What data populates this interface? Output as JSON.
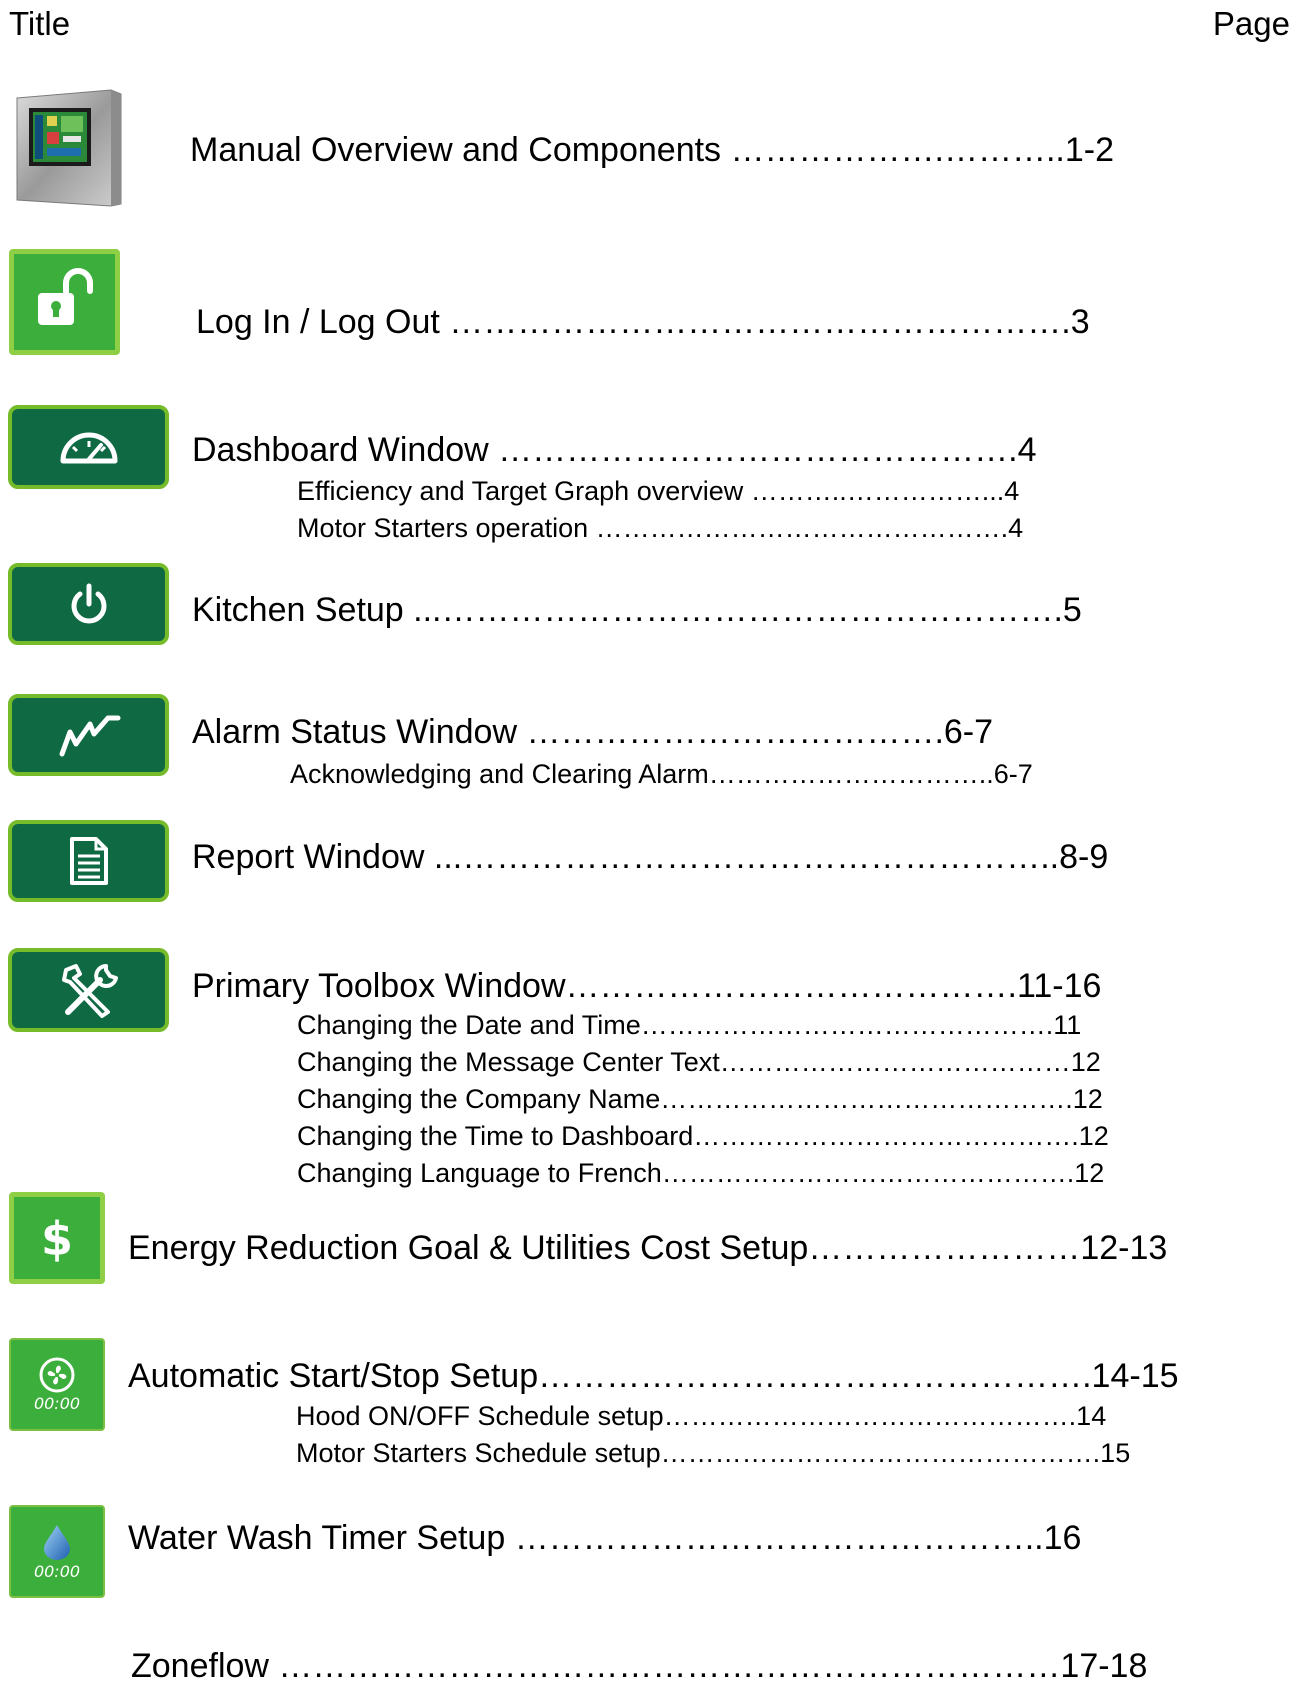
{
  "header": {
    "title_label": "Title",
    "page_label": "Page"
  },
  "colors": {
    "button_dark_green": "#0f6a44",
    "button_border_lime": "#76bb2a",
    "button_bright_green": "#3cae3b"
  },
  "entries": [
    {
      "text": "Manual Overview and Components ……………….………..1-2",
      "icon": "control-panel-photo"
    },
    {
      "text": "Log In / Log Out ……………………………………………….3",
      "icon": "padlock-open-icon"
    },
    {
      "text": "Dashboard Window ……………………………………….4",
      "icon": "gauge-icon"
    },
    {
      "text": "Efficiency and Target Graph overview ………..……………...4"
    },
    {
      "text": "Motor Starters operation ……………………………………….4"
    },
    {
      "text": "Kitchen Setup ...……………………………………………….5",
      "icon": "power-icon"
    },
    {
      "text": "Alarm Status Window ……………………………….6-7",
      "icon": "alarm-graph-icon"
    },
    {
      "text": "Acknowledging and Clearing Alarm…………………………..6-7"
    },
    {
      "text": "Report Window ...……………………………………………..8-9",
      "icon": "report-document-icon"
    },
    {
      "text": "Primary Toolbox Window………………………………….11-16",
      "icon": "tools-icon"
    },
    {
      "text": "Changing the Date and Time……………………………………….11"
    },
    {
      "text": "Changing the Message Center Text…………………………………12"
    },
    {
      "text": "Changing the Company Name……………………………………….12"
    },
    {
      "text": "Changing the Time to Dashboard…………………………………….12"
    },
    {
      "text": "Changing Language to French……………………………………….12"
    },
    {
      "text": "Energy Reduction Goal & Utilities Cost Setup……………………12-13",
      "icon": "dollar-icon"
    },
    {
      "text": "Automatic Start/Stop Setup………………………………………….14-15",
      "icon": "fan-timer-icon",
      "icon_label": "00:00"
    },
    {
      "text": "Hood ON/OFF Schedule setup……………………………………….14"
    },
    {
      "text": "Motor Starters Schedule setup………………………………………….15"
    },
    {
      "text": "Water Wash Timer Setup ………………………………………..16",
      "icon": "water-drop-timer-icon",
      "icon_label": "00:00"
    },
    {
      "text": "Zoneflow ……………………………………………………………17-18"
    }
  ]
}
